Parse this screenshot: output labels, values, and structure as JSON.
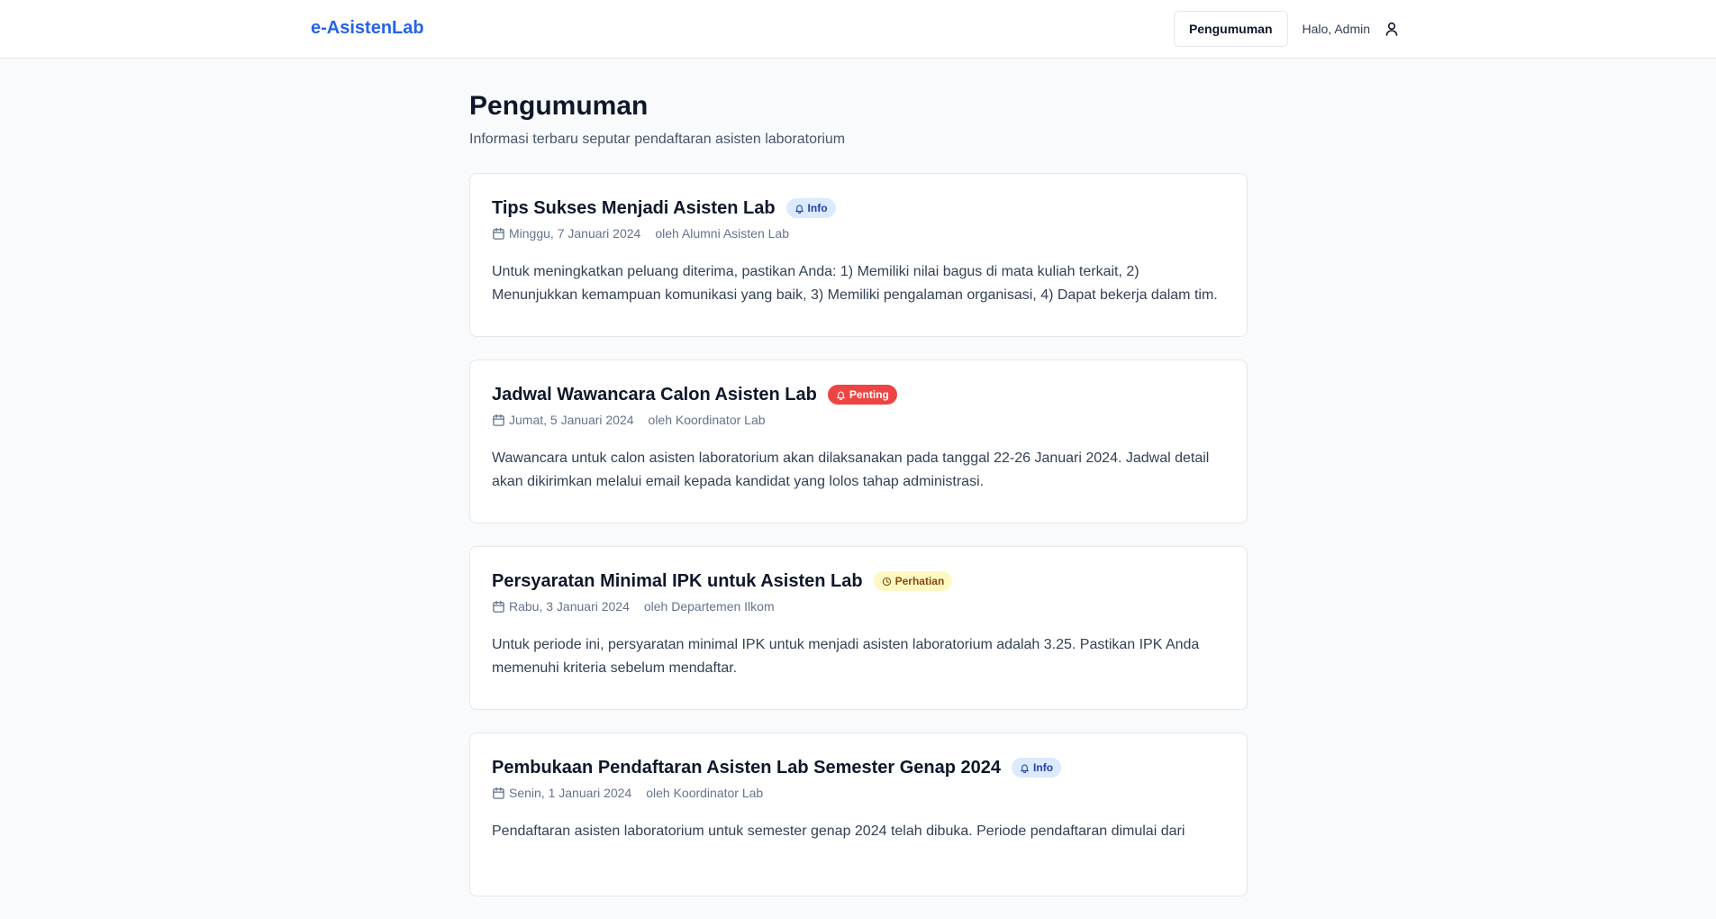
{
  "brand": "e-AsistenLab",
  "nav": {
    "announcements_button": "Pengumuman",
    "greeting": "Halo, Admin",
    "user_icon": "user-icon"
  },
  "page": {
    "title": "Pengumuman",
    "subtitle": "Informasi terbaru seputar pendaftaran asisten laboratorium"
  },
  "colors": {
    "brand": "#2563eb",
    "info_badge_bg": "#dbeafe",
    "important_badge_bg": "#ef4444",
    "attention_badge_bg": "#fef9c3"
  },
  "announcements": [
    {
      "title": "Tips Sukses Menjadi Asisten Lab",
      "badge": "Info",
      "badge_type": "info",
      "badge_icon": "bell-icon",
      "date": "Minggu, 7 Januari 2024",
      "author": "oleh Alumni Asisten Lab",
      "body": "Untuk meningkatkan peluang diterima, pastikan Anda: 1) Memiliki nilai bagus di mata kuliah terkait, 2) Menunjukkan kemampuan komunikasi yang baik, 3) Memiliki pengalaman organisasi, 4) Dapat bekerja dalam tim."
    },
    {
      "title": "Jadwal Wawancara Calon Asisten Lab",
      "badge": "Penting",
      "badge_type": "important",
      "badge_icon": "bell-icon",
      "date": "Jumat, 5 Januari 2024",
      "author": "oleh Koordinator Lab",
      "body": "Wawancara untuk calon asisten laboratorium akan dilaksanakan pada tanggal 22-26 Januari 2024. Jadwal detail akan dikirimkan melalui email kepada kandidat yang lolos tahap administrasi."
    },
    {
      "title": "Persyaratan Minimal IPK untuk Asisten Lab",
      "badge": "Perhatian",
      "badge_type": "attention",
      "badge_icon": "clock-icon",
      "date": "Rabu, 3 Januari 2024",
      "author": "oleh Departemen Ilkom",
      "body": "Untuk periode ini, persyaratan minimal IPK untuk menjadi asisten laboratorium adalah 3.25. Pastikan IPK Anda memenuhi kriteria sebelum mendaftar."
    },
    {
      "title": "Pembukaan Pendaftaran Asisten Lab Semester Genap 2024",
      "badge": "Info",
      "badge_type": "info",
      "badge_icon": "bell-icon",
      "date": "Senin, 1 Januari 2024",
      "author": "oleh Koordinator Lab",
      "body": "Pendaftaran asisten laboratorium untuk semester genap 2024 telah dibuka. Periode pendaftaran dimulai dari"
    }
  ]
}
